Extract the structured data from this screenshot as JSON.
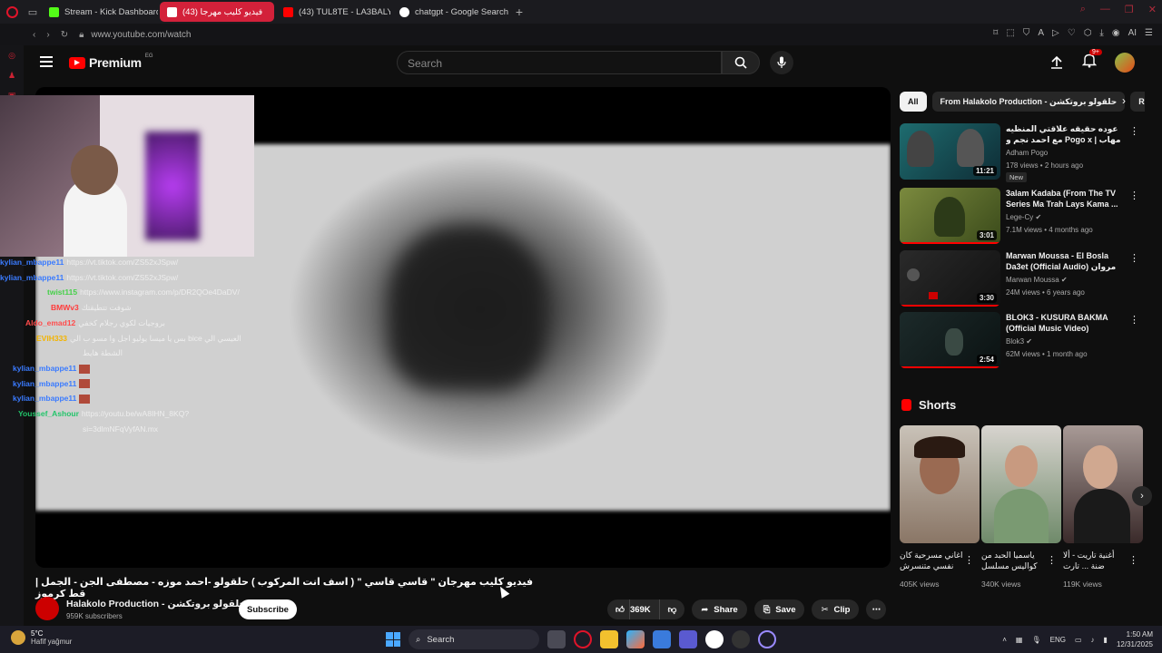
{
  "browser": {
    "tabs": [
      {
        "title": "Stream - Kick Dashboard",
        "color": "#53fc18"
      },
      {
        "title": "فيديو كليب مهرجا (43)",
        "color": "#ff0000"
      },
      {
        "title": "(43) TUL8TE - LA3BALY I",
        "color": "#ff0000"
      },
      {
        "title": "chatgpt - Google Search",
        "color": "#ffffff"
      }
    ],
    "url": "www.youtube.com/watch",
    "extension_label": "AI"
  },
  "header": {
    "logo_text": "Premium",
    "region": "EG",
    "search_placeholder": "Search",
    "notif_count": "9+"
  },
  "chat": [
    {
      "user": "kylian_mbappe11",
      "color": "#3a7bff",
      "msg": "https://vt.tiktok.com/ZS52xJSpw/"
    },
    {
      "user": "kylian_mbappe11",
      "color": "#3a7bff",
      "msg": "https://vt.tiktok.com/ZS52xJSpw/"
    },
    {
      "user": "twist115",
      "color": "#46d04a",
      "msg": "https://www.instagram.com/p/DR2QOe4DaDV/"
    },
    {
      "user": "BMWv3",
      "color": "#ff3a3a",
      "msg": "شوفت تتطيقتك"
    },
    {
      "user": "Aldo_emad12",
      "color": "#ff4c4c",
      "msg": "بروجيات لكوي رجلام كخفي"
    },
    {
      "user": "EVIH333",
      "color": "#f3b400",
      "msg": "بس يا ميسا يوليو اجل وا مسو ب الي bice العيسي الي"
    },
    {
      "user": "",
      "color": "#ffffff",
      "msg": "الشطة هايط"
    },
    {
      "user": "kylian_mbappe11",
      "color": "#3a7bff",
      "msg": ""
    },
    {
      "user": "kylian_mbappe11",
      "color": "#3a7bff",
      "msg": ""
    },
    {
      "user": "kylian_mbappe11",
      "color": "#3a7bff",
      "msg": ""
    },
    {
      "user": "Youssef_Ashour",
      "color": "#22c56a",
      "msg": "https://youtu.be/wA8IHN_8KQ?"
    },
    {
      "user": "",
      "color": "#ffffff",
      "msg": "si=3dlmNFqVyfAN.mx"
    }
  ],
  "video": {
    "title": "فيديو كليب مهرجان \" قاسي قاسي \" ( اسف انت المركوب ) حلقولو -احمد موزه - مصطفى الجن - الجمل | قط كرموز",
    "channel": "Halakolo Production - حلقولو بروتكشن",
    "subscribers": "959K subscribers",
    "subscribe_label": "Subscribe",
    "likes": "369K",
    "share_label": "Share",
    "save_label": "Save",
    "clip_label": "Clip"
  },
  "chips": [
    "All",
    "From Halakolo Production - حلقولو بروتكشن",
    "Related"
  ],
  "recommendations": [
    {
      "title": "عوده حقيقه علاقتي المنظيه مع احمد نجم و Pogo x | مهاب شادي ...",
      "channel": "Adham Pogo",
      "meta": "178 views • 2 hours ago",
      "duration": "11:21",
      "badge": "New",
      "colors": [
        "#1e6c6f",
        "#0e2c35"
      ],
      "progress": 0.0
    },
    {
      "title": "3alam Kadaba (From The TV Series Ma Trah Lays Kama ...",
      "channel": "Lege-Cy",
      "meta": "7.1M views • 4 months ago",
      "duration": "3:01",
      "badge": "",
      "colors": [
        "#7b8a3e",
        "#3a4a1a"
      ],
      "progress": 1.0
    },
    {
      "title": "Marwan Moussa - El Bosla Da3et (Official Audio) مروان موسى",
      "channel": "Marwan Moussa",
      "meta": "24M views • 6 years ago",
      "duration": "3:30",
      "badge": "",
      "colors": [
        "#2a2a2a",
        "#111111"
      ],
      "progress": 1.0
    },
    {
      "title": "BLOK3 - KUSURA BAKMA (Official Music Video)",
      "channel": "Blok3",
      "meta": "62M views • 1 month ago",
      "duration": "2:54",
      "badge": "",
      "colors": [
        "#1c2a2a",
        "#0b1212"
      ],
      "progress": 1.0
    }
  ],
  "shorts": {
    "heading": "Shorts",
    "items": [
      {
        "title": "اغاني مسرحية كان نفسي متنسرش",
        "views": "405K views",
        "colors": [
          "#c9c2b8",
          "#8a7666"
        ]
      },
      {
        "title": "ياسميا الحبد من كواليس مسلسل",
        "views": "340K views",
        "colors": [
          "#b9c9b0",
          "#6f8a6a"
        ]
      },
      {
        "title": "أغنية تاريت - ألا ضنة ... تارت",
        "views": "119K views",
        "colors": [
          "#9a8a8a",
          "#3a2a2a"
        ]
      }
    ]
  },
  "taskbar": {
    "temp": "5°C",
    "weather": "Hafif yağmur",
    "search_label": "Search",
    "lang": "ENG",
    "time": "1:50 AM",
    "date": "12/31/2025"
  }
}
